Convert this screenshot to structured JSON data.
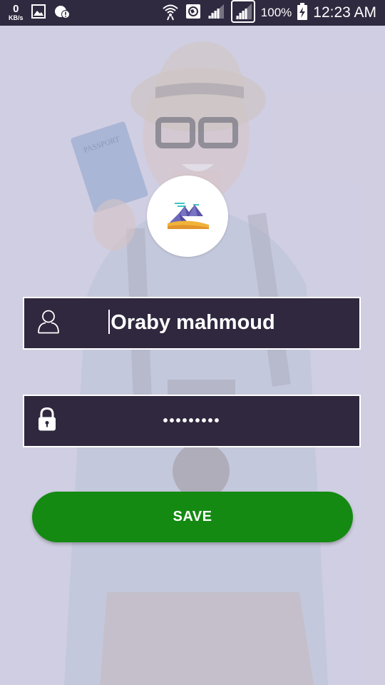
{
  "status_bar": {
    "speed_value": "0",
    "speed_unit": "KB/s",
    "battery": "100%",
    "time": "12:23 AM"
  },
  "form": {
    "name_value": "Oraby mahmoud",
    "password_value": "•••••••••",
    "save_label": "SAVE"
  },
  "colors": {
    "field_bg": "#30283f",
    "save_button": "#148a12",
    "status_bar": "#2f2a40"
  }
}
